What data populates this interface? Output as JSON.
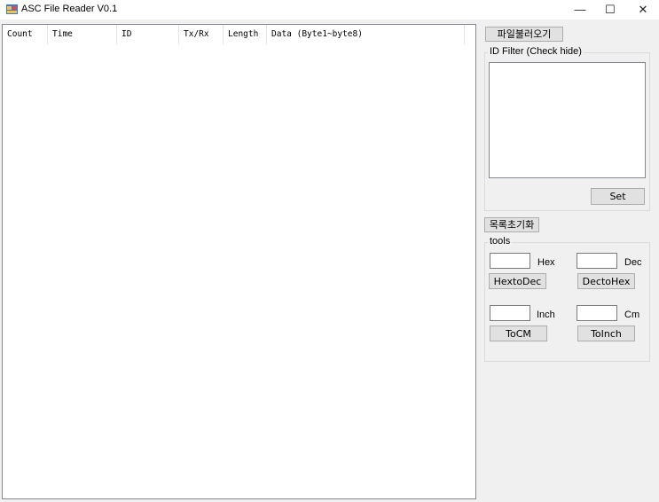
{
  "window": {
    "title": "ASC File Reader V0.1",
    "icon": "app-icon",
    "minimize_glyph": "—",
    "maximize_glyph": "☐",
    "close_glyph": "✕"
  },
  "table": {
    "columns": [
      "Count",
      "Time",
      "ID",
      "Tx/Rx",
      "Length",
      "Data (Byte1~byte8)"
    ],
    "rows": []
  },
  "side": {
    "load_file_button": "파일불러오기",
    "id_filter_label": "ID Filter (Check hide)",
    "set_button": "Set",
    "reset_list_button": "목록초기화",
    "tools_label": "tools",
    "hex_label": "Hex",
    "dec_label": "Dec",
    "hex_to_dec_button": "HextoDec",
    "dec_to_hex_button": "DectoHex",
    "inch_label": "Inch",
    "cm_label": "Cm",
    "to_cm_button": "ToCM",
    "to_inch_button": "ToInch",
    "hex_value": "",
    "dec_value": "",
    "inch_value": "",
    "cm_value": ""
  }
}
